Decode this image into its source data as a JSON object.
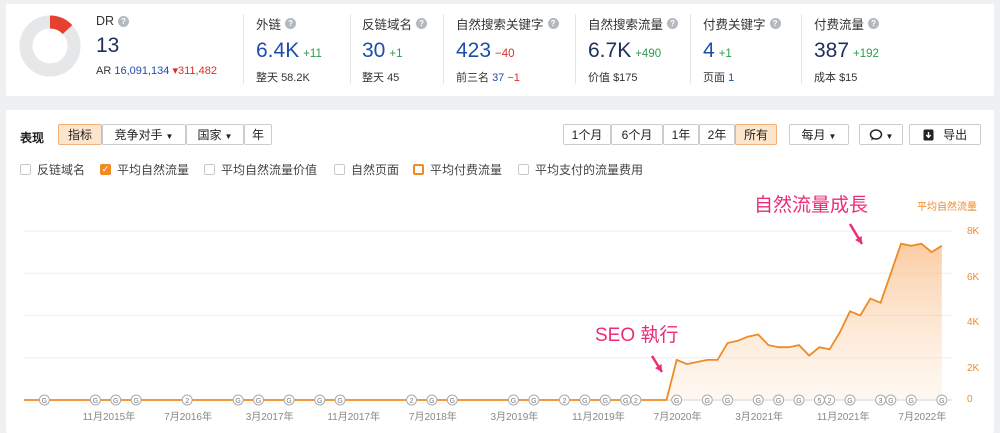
{
  "dr": {
    "label": "DR",
    "value": "13",
    "ar_label": "AR",
    "ar_value": "16,091,134",
    "ar_delta": "311,482",
    "ratio": 0.13
  },
  "backlinks": {
    "label": "外链",
    "value": "6.4K",
    "delta": "+11",
    "sub_label": "整天",
    "sub_value": "58.2K"
  },
  "ref_domains": {
    "label": "反链域名",
    "value": "30",
    "delta": "+1",
    "sub_label": "整天",
    "sub_value": "45"
  },
  "organic_keywords": {
    "label": "自然搜索关键字",
    "value": "423",
    "delta": "−40",
    "sub_label": "前三名",
    "sub_value": "37",
    "sub_delta": "−1"
  },
  "organic_traffic": {
    "label": "自然搜索流量",
    "value": "6.7K",
    "delta": "+490",
    "sub_label": "价值",
    "sub_value": "$175"
  },
  "paid_keywords": {
    "label": "付费关键字",
    "value": "4",
    "delta": "+1",
    "sub_label": "页面",
    "sub_value": "1"
  },
  "paid_traffic": {
    "label": "付费流量",
    "value": "387",
    "delta": "+192",
    "sub_label": "成本",
    "sub_value": "$15"
  },
  "toolbar": {
    "title": "表现",
    "metrics_tab": "指标",
    "competitors": "竞争对手",
    "country": "国家",
    "year": "年",
    "ranges": [
      "1个月",
      "6个月",
      "1年",
      "2年",
      "所有"
    ],
    "interval": "每月",
    "export": "导出"
  },
  "legend": {
    "ref_domains": "反链域名",
    "avg_organic": "平均自然流量",
    "avg_organic_value": "平均自然流量价值",
    "organic_pages": "自然页面",
    "avg_paid": "平均付费流量",
    "avg_paid_cost": "平均支付的流量费用"
  },
  "annotations": {
    "growth": "自然流量成長",
    "seo": "SEO 執行"
  },
  "colors": {
    "accent": "#f08a24",
    "annotation": "#ee2b78",
    "blue": "#1f4ea8"
  },
  "chart_data": {
    "type": "area",
    "series": [
      {
        "name": "平均自然流量",
        "x": [
          "2015-03",
          "2015-06",
          "2015-09",
          "2015-12",
          "2016-03",
          "2016-06",
          "2016-09",
          "2016-12",
          "2017-03",
          "2017-06",
          "2017-09",
          "2017-12",
          "2018-03",
          "2018-06",
          "2018-09",
          "2018-12",
          "2019-03",
          "2019-06",
          "2019-09",
          "2019-12",
          "2020-03",
          "2020-06",
          "2020-07",
          "2020-08",
          "2020-09",
          "2020-10",
          "2020-11",
          "2020-12",
          "2021-01",
          "2021-02",
          "2021-03",
          "2021-04",
          "2021-05",
          "2021-06",
          "2021-07",
          "2021-08",
          "2021-09",
          "2021-10",
          "2021-11",
          "2021-12",
          "2022-01",
          "2022-02",
          "2022-03",
          "2022-04",
          "2022-05",
          "2022-06",
          "2022-07",
          "2022-08",
          "2022-09"
        ],
        "values": [
          0,
          0,
          0,
          0,
          0,
          0,
          0,
          0,
          0,
          0,
          0,
          0,
          0,
          0,
          0,
          0,
          0,
          0,
          0,
          0,
          0,
          0,
          1900,
          1700,
          1800,
          1900,
          1900,
          2700,
          2800,
          3000,
          3100,
          2600,
          2500,
          2500,
          2600,
          2100,
          2500,
          2400,
          3200,
          4200,
          4000,
          4800,
          4600,
          6000,
          7400,
          7300,
          7400,
          7000,
          7300
        ]
      }
    ],
    "y_ticks": [
      "0",
      "2K",
      "4K",
      "6K",
      "8K"
    ],
    "ylim": [
      0,
      8000
    ],
    "x_ticks": [
      "11月2015年",
      "7月2016年",
      "3月2017年",
      "11月2017年",
      "7月2018年",
      "3月2019年",
      "11月2019年",
      "7月2020年",
      "3月2021年",
      "11月2021年",
      "7月2022年"
    ],
    "x_tick_values": [
      "2015-11",
      "2016-07",
      "2017-03",
      "2017-11",
      "2018-07",
      "2019-03",
      "2019-11",
      "2020-07",
      "2021-03",
      "2021-11",
      "2022-07"
    ],
    "xlim": [
      "2015-03",
      "2022-10"
    ],
    "axis_title": "平均自然流量",
    "grid": true,
    "markers": [
      {
        "x": "2015-05",
        "label": "G"
      },
      {
        "x": "2015-10",
        "label": "G"
      },
      {
        "x": "2015-12",
        "label": "G"
      },
      {
        "x": "2016-02",
        "label": "G"
      },
      {
        "x": "2016-07",
        "label": "2"
      },
      {
        "x": "2016-12",
        "label": "G"
      },
      {
        "x": "2017-02",
        "label": "G"
      },
      {
        "x": "2017-05",
        "label": "G"
      },
      {
        "x": "2017-08",
        "label": "G"
      },
      {
        "x": "2017-10",
        "label": "G"
      },
      {
        "x": "2018-05",
        "label": "2"
      },
      {
        "x": "2018-07",
        "label": "G"
      },
      {
        "x": "2018-09",
        "label": "G"
      },
      {
        "x": "2019-03",
        "label": "G"
      },
      {
        "x": "2019-05",
        "label": "G"
      },
      {
        "x": "2019-08",
        "label": "2"
      },
      {
        "x": "2019-10",
        "label": "G"
      },
      {
        "x": "2019-12",
        "label": "G"
      },
      {
        "x": "2020-02",
        "label": "G"
      },
      {
        "x": "2020-03",
        "label": "2"
      },
      {
        "x": "2020-07",
        "label": "G"
      },
      {
        "x": "2020-10",
        "label": "G"
      },
      {
        "x": "2020-12",
        "label": "G"
      },
      {
        "x": "2021-03",
        "label": "G"
      },
      {
        "x": "2021-05",
        "label": "G"
      },
      {
        "x": "2021-07",
        "label": "G"
      },
      {
        "x": "2021-09",
        "label": "5"
      },
      {
        "x": "2021-10",
        "label": "2"
      },
      {
        "x": "2021-12",
        "label": "G"
      },
      {
        "x": "2022-03",
        "label": "3"
      },
      {
        "x": "2022-04",
        "label": "G"
      },
      {
        "x": "2022-06",
        "label": "G"
      },
      {
        "x": "2022-09",
        "label": "G"
      }
    ]
  }
}
